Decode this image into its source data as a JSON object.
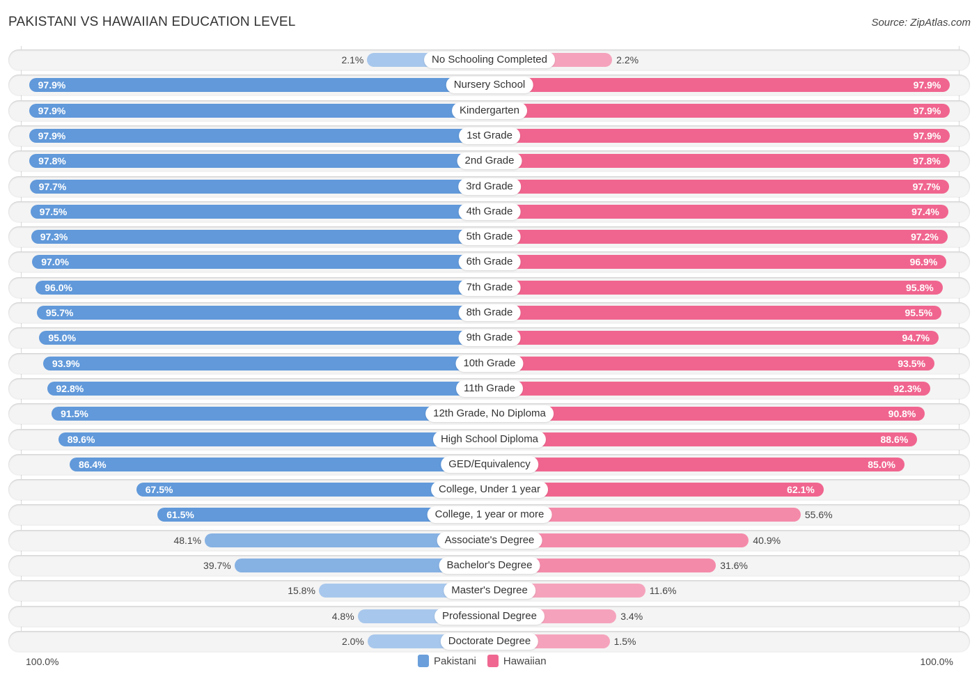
{
  "header": {
    "title": "PAKISTANI VS HAWAIIAN EDUCATION LEVEL",
    "source": "Source: ZipAtlas.com"
  },
  "axis": {
    "left_label": "100.0%",
    "right_label": "100.0%"
  },
  "legend": [
    {
      "name": "Pakistani",
      "color": "#6a9fdb"
    },
    {
      "name": "Hawaiian",
      "color": "#f06892"
    }
  ],
  "colors": {
    "pakistani_strong": "#6199da",
    "pakistani_light": "#a8c7ec",
    "hawaiian_strong": "#f0658f",
    "hawaiian_light": "#f5a3bc"
  },
  "chart_data": {
    "type": "bar",
    "orientation": "horizontal-diverging",
    "title": "PAKISTANI VS HAWAIIAN EDUCATION LEVEL",
    "xlabel": "",
    "ylabel": "",
    "xlim": [
      0,
      100
    ],
    "legend_position": "bottom-center",
    "categories": [
      "No Schooling Completed",
      "Nursery School",
      "Kindergarten",
      "1st Grade",
      "2nd Grade",
      "3rd Grade",
      "4th Grade",
      "5th Grade",
      "6th Grade",
      "7th Grade",
      "8th Grade",
      "9th Grade",
      "10th Grade",
      "11th Grade",
      "12th Grade, No Diploma",
      "High School Diploma",
      "GED/Equivalency",
      "College, Under 1 year",
      "College, 1 year or more",
      "Associate's Degree",
      "Bachelor's Degree",
      "Master's Degree",
      "Professional Degree",
      "Doctorate Degree"
    ],
    "series": [
      {
        "name": "Pakistani",
        "values": [
          2.1,
          97.9,
          97.9,
          97.9,
          97.8,
          97.7,
          97.5,
          97.3,
          97.0,
          96.0,
          95.7,
          95.0,
          93.9,
          92.8,
          91.5,
          89.6,
          86.4,
          67.5,
          61.5,
          48.1,
          39.7,
          15.8,
          4.8,
          2.0
        ],
        "labels": [
          "2.1%",
          "97.9%",
          "97.9%",
          "97.9%",
          "97.8%",
          "97.7%",
          "97.5%",
          "97.3%",
          "97.0%",
          "96.0%",
          "95.7%",
          "95.0%",
          "93.9%",
          "92.8%",
          "91.5%",
          "89.6%",
          "86.4%",
          "67.5%",
          "61.5%",
          "48.1%",
          "39.7%",
          "15.8%",
          "4.8%",
          "2.0%"
        ]
      },
      {
        "name": "Hawaiian",
        "values": [
          2.2,
          97.9,
          97.9,
          97.9,
          97.8,
          97.7,
          97.4,
          97.2,
          96.9,
          95.8,
          95.5,
          94.7,
          93.5,
          92.3,
          90.8,
          88.6,
          85.0,
          62.1,
          55.6,
          40.9,
          31.6,
          11.6,
          3.4,
          1.5
        ],
        "labels": [
          "2.2%",
          "97.9%",
          "97.9%",
          "97.9%",
          "97.8%",
          "97.7%",
          "97.4%",
          "97.2%",
          "96.9%",
          "95.8%",
          "95.5%",
          "94.7%",
          "93.5%",
          "92.3%",
          "90.8%",
          "88.6%",
          "85.0%",
          "62.1%",
          "55.6%",
          "40.9%",
          "31.6%",
          "11.6%",
          "3.4%",
          "1.5%"
        ]
      }
    ]
  }
}
